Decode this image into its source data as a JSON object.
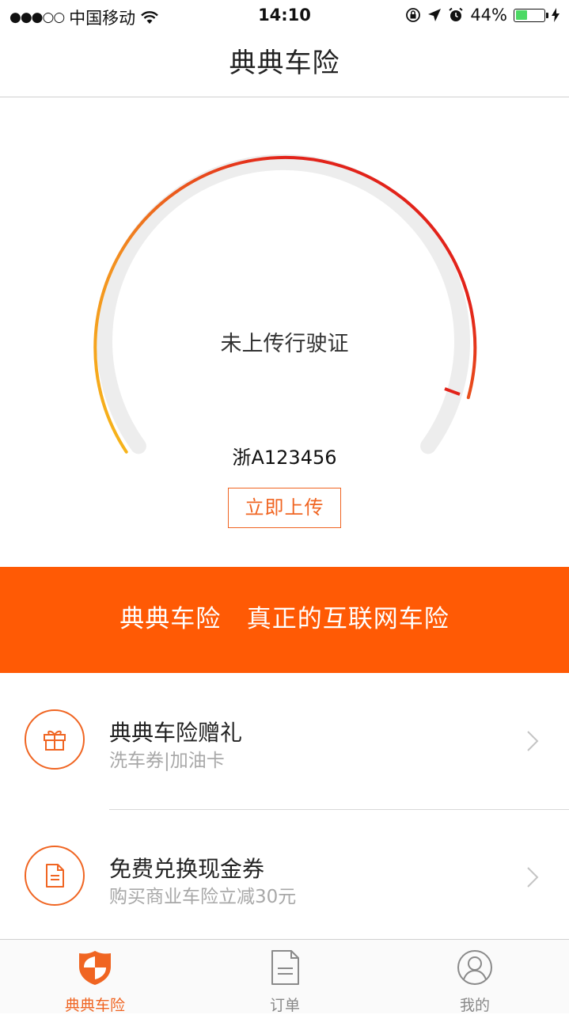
{
  "status_bar": {
    "signal_dots": "●●●○○",
    "carrier": "中国移动",
    "time": "14:10",
    "battery_percent": "44%",
    "battery_level": 0.44,
    "icons": [
      "wifi-icon",
      "orientation-lock-icon",
      "location-arrow-icon",
      "alarm-icon",
      "battery-icon",
      "charging-bolt-icon"
    ]
  },
  "header": {
    "title": "典典车险"
  },
  "gauge": {
    "status_text": "未上传行驶证",
    "plate_number": "浙A123456",
    "upload_button_label": "立即上传",
    "colors": {
      "track": "#ededed",
      "gradient_start": "#f7b81a",
      "gradient_mid": "#f39020",
      "gradient_end": "#e2231a",
      "marker": "#e2231a"
    }
  },
  "banner": {
    "text": "典典车险   真正的互联网车险",
    "color": "#ff5a05"
  },
  "list_items": [
    {
      "title": "典典车险赠礼",
      "subtitle": "洗车券|加油卡",
      "icon": "gift-icon"
    },
    {
      "title": "免费兑换现金券",
      "subtitle": "购买商业车险立减30元",
      "icon": "document-icon"
    }
  ],
  "tab_bar": {
    "tabs": [
      {
        "label": "典典车险",
        "icon": "shield-icon",
        "active": true
      },
      {
        "label": "订单",
        "icon": "order-document-icon",
        "active": false
      },
      {
        "label": "我的",
        "icon": "profile-icon",
        "active": false
      }
    ],
    "active_color": "#f06522"
  }
}
